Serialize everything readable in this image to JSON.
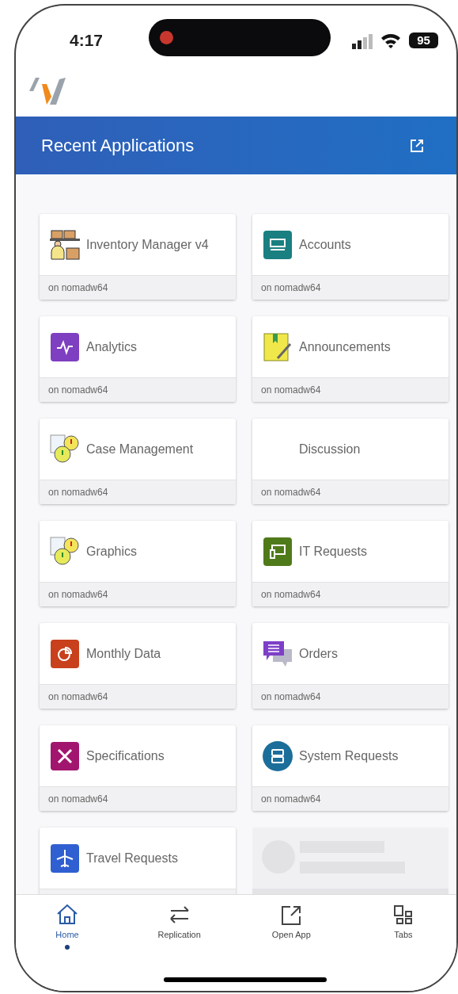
{
  "status_bar": {
    "time": "4:17",
    "battery": "95"
  },
  "header": {
    "title": "Recent Applications"
  },
  "apps": [
    {
      "kind": "app",
      "name": "Inventory Manager v4",
      "server": "on nomadw64"
    },
    {
      "kind": "app",
      "name": "Accounts",
      "server": "on nomadw64"
    },
    {
      "kind": "app",
      "name": "Analytics",
      "server": "on nomadw64"
    },
    {
      "kind": "app",
      "name": "Announcements",
      "server": "on nomadw64"
    },
    {
      "kind": "app",
      "name": "Case Management",
      "server": "on nomadw64"
    },
    {
      "kind": "app",
      "name": "Discussion",
      "server": "on nomadw64"
    },
    {
      "kind": "app",
      "name": "Graphics",
      "server": "on nomadw64"
    },
    {
      "kind": "app",
      "name": "IT Requests",
      "server": "on nomadw64"
    },
    {
      "kind": "app",
      "name": "Monthly Data",
      "server": "on nomadw64"
    },
    {
      "kind": "app",
      "name": "Orders",
      "server": "on nomadw64"
    },
    {
      "kind": "app",
      "name": "Specifications",
      "server": "on nomadw64"
    },
    {
      "kind": "app",
      "name": "System Requests",
      "server": "on nomadw64"
    },
    {
      "kind": "app",
      "name": "Travel Requests"
    },
    {
      "kind": "skeleton"
    }
  ],
  "tabs": [
    {
      "label": "Home",
      "selected": true
    },
    {
      "label": "Replication",
      "selected": false
    },
    {
      "label": "Open App",
      "selected": false
    },
    {
      "label": "Tabs",
      "selected": false
    }
  ]
}
